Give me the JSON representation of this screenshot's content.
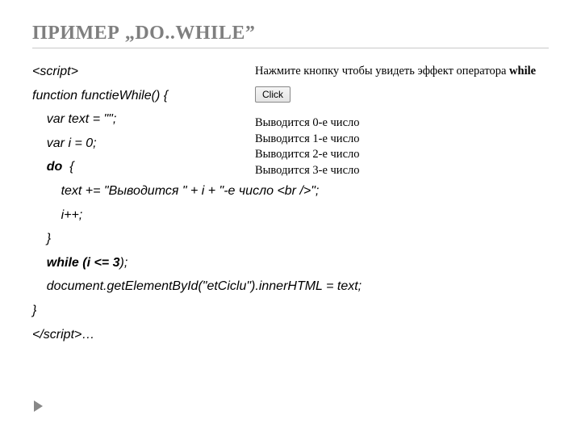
{
  "title": "ПРИМЕР  „DO..WHILE”",
  "code": {
    "l01": "<script>",
    "l02": "function functieWhile() {",
    "l03": "    var text = \"\";",
    "l04": "    var i = 0;",
    "l05a": "    ",
    "l05b": "do",
    "l05c": "  {",
    "l06": "        text += \"Выводится \" + i + \"-е число <br />\";",
    "l07": "        i++;",
    "l08": "    }",
    "l09a": "    ",
    "l09b": "while (i <= 3",
    "l09c": ");",
    "l10": "    document.getElementById(\"etCiclu\").innerHTML = text;",
    "l11": "}",
    "l12": "</script>…"
  },
  "demo": {
    "caption_prefix": "Нажмите кнопку чтобы увидеть эффект оператора ",
    "caption_bold": "while",
    "button": "Click",
    "out1": "Выводится 0-е число",
    "out2": "Выводится 1-е число",
    "out3": "Выводится 2-е число",
    "out4": "Выводится 3-е число"
  }
}
